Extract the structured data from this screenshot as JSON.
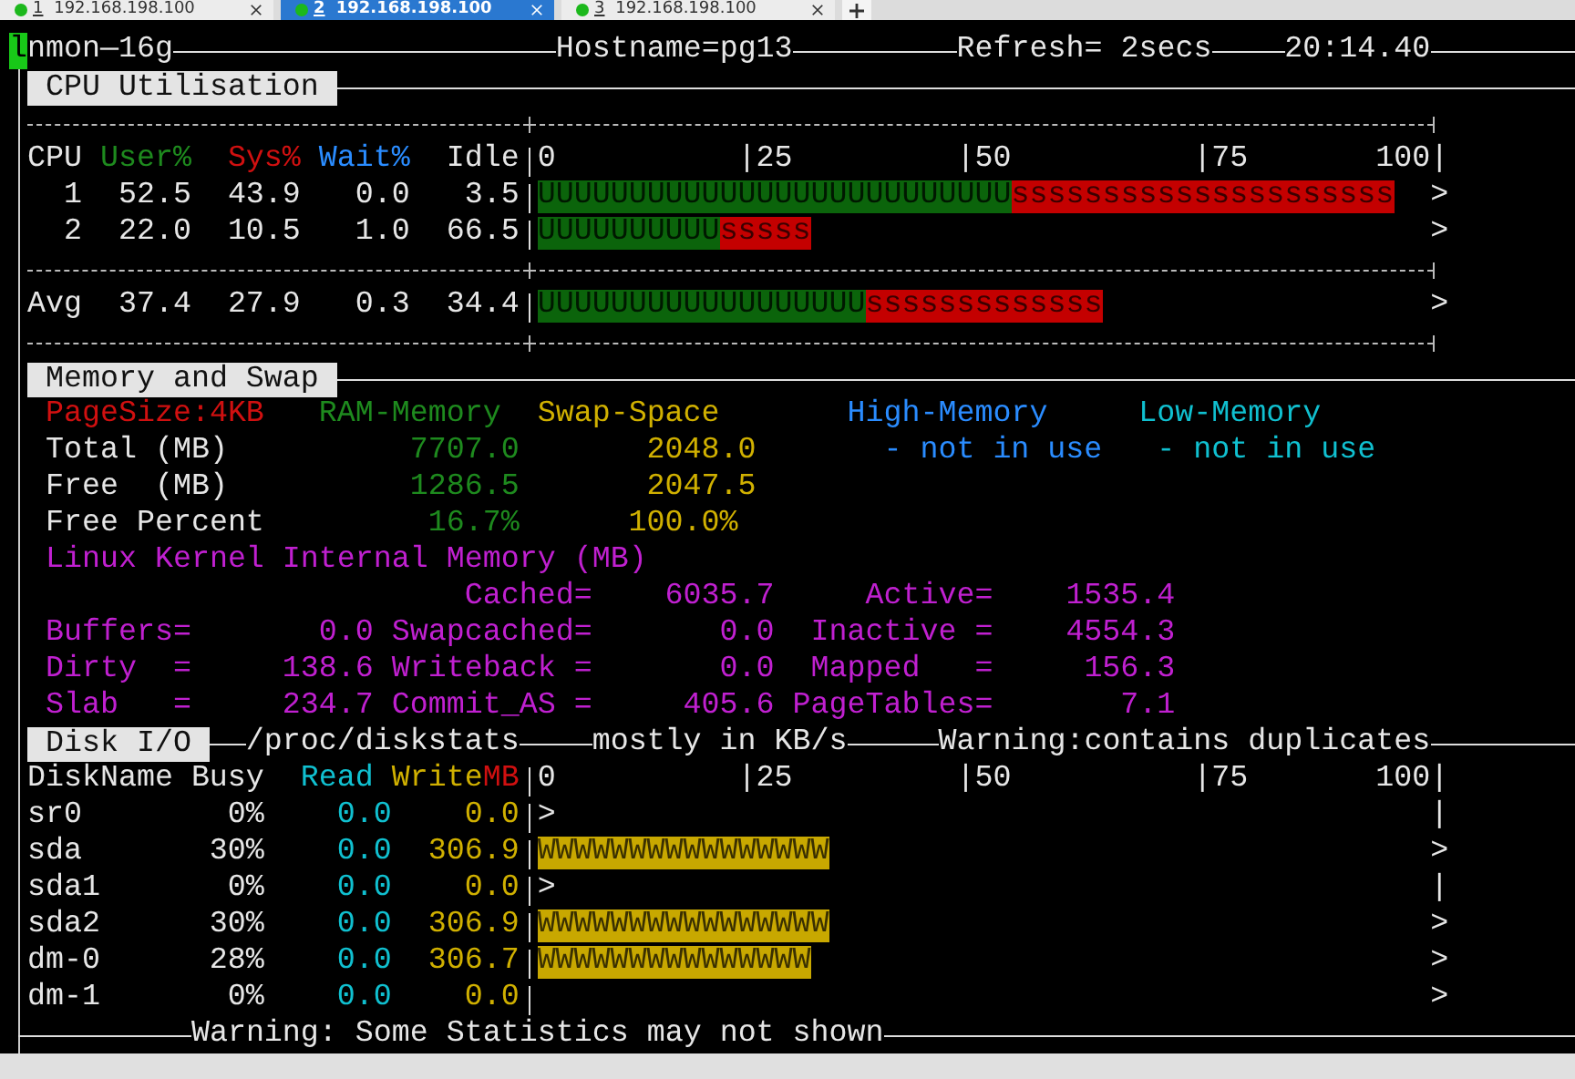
{
  "tabs": [
    {
      "number": "1",
      "address": "192.168.198.100",
      "selected": false
    },
    {
      "number": "2",
      "address": "192.168.198.100",
      "selected": true
    },
    {
      "number": "3",
      "address": "192.168.198.100",
      "selected": false
    }
  ],
  "header": {
    "cursor": "l",
    "program": "nmon—16g",
    "hostname": "Hostname=pg13",
    "refresh": "Refresh= 2secs",
    "time": "20:14.40"
  },
  "cpu": {
    "title": "CPU Utilisation",
    "columns": {
      "cpu": "CPU",
      "user": "User%",
      "sys": "Sys%",
      "wait": "Wait%",
      "idle": "Idle"
    },
    "scale": [
      "0",
      "|25",
      "|50",
      "|75",
      "100|"
    ],
    "rows": [
      {
        "cpu": "1",
        "user": "52.5",
        "sys": "43.9",
        "wait": "0.0",
        "idle": "3.5",
        "user_bar": "UUUUUUUUUUUUUUUUUUUUUUUUUU",
        "sys_bar": "sssssssssssssssssssss",
        "end_mark": ">"
      },
      {
        "cpu": "2",
        "user": "22.0",
        "sys": "10.5",
        "wait": "1.0",
        "idle": "66.5",
        "user_bar": "UUUUUUUUUU",
        "sys_bar": "sssss",
        "end_mark": ">"
      }
    ],
    "average": {
      "cpu": "Avg",
      "user": "37.4",
      "sys": "27.9",
      "wait": "0.3",
      "idle": "34.4",
      "user_bar": "UUUUUUUUUUUUUUUUUU",
      "sys_bar": "sssssssssssss",
      "end_mark": ">"
    }
  },
  "memory": {
    "title": "Memory and Swap",
    "page_size": "PageSize:4KB",
    "ram_heading": "RAM-Memory",
    "swap_heading": "Swap-Space",
    "high_heading": "High-Memory",
    "low_heading": "Low-Memory",
    "rows": [
      {
        "kind": "mb",
        "label": "Total (MB)",
        "ram": "7707.0",
        "swap": "2048.0",
        "high": "- not in use",
        "low": "- not in use"
      },
      {
        "kind": "mb",
        "label": "Free  (MB)",
        "ram": "1286.5",
        "swap": "2047.5"
      },
      {
        "kind": "percent",
        "label": "Free Percent",
        "ram": "16.7%",
        "swap": "100.0%"
      }
    ],
    "kernel_title": "Linux Kernel Internal Memory (MB)",
    "kernel_rows": [
      {
        "entries": [
          {
            "label": "Cached=",
            "value": "6035.7"
          },
          {
            "label": "Active=",
            "value": "1535.4"
          }
        ]
      },
      {
        "entries": [
          {
            "label": "Buffers=",
            "value": "0.0"
          },
          {
            "label": "Swapcached=",
            "value": "0.0"
          },
          {
            "label": "Inactive =",
            "value": "4554.3"
          }
        ]
      },
      {
        "entries": [
          {
            "label": "Dirty  =",
            "value": "138.6"
          },
          {
            "label": "Writeback =",
            "value": "0.0"
          },
          {
            "label": "Mapped   =",
            "value": "156.3"
          }
        ]
      },
      {
        "entries": [
          {
            "label": "Slab   =",
            "value": "234.7"
          },
          {
            "label": "Commit_AS =",
            "value": "405.6"
          },
          {
            "label": "PageTables=",
            "value": "7.1"
          }
        ]
      }
    ]
  },
  "disk": {
    "title": "Disk I/O",
    "source": "/proc/diskstats",
    "units": "mostly in KB/s",
    "warning": "Warning:contains duplicates",
    "columns": {
      "name": "DiskName",
      "busy": "Busy",
      "read": "Read",
      "write": "Write",
      "unit": "MB"
    },
    "scale": [
      "0",
      "|25",
      "|50",
      "|75",
      "100|"
    ],
    "rows": [
      {
        "kind": "idle",
        "name": "sr0",
        "busy": "0%",
        "read": "0.0",
        "write": "0.0",
        "bar": ">",
        "end_mark": "|"
      },
      {
        "kind": "bar",
        "name": "sda",
        "busy": "30%",
        "read": "0.0",
        "write": "306.9",
        "bar": "WWWWWWWWWWWWWWWW",
        "end_mark": ">"
      },
      {
        "kind": "idle",
        "name": "sda1",
        "busy": "0%",
        "read": "0.0",
        "write": "0.0",
        "bar": ">",
        "end_mark": "|"
      },
      {
        "kind": "bar",
        "name": "sda2",
        "busy": "30%",
        "read": "0.0",
        "write": "306.9",
        "bar": "WWWWWWWWWWWWWWWW",
        "end_mark": ">"
      },
      {
        "kind": "bar",
        "name": "dm-0",
        "busy": "28%",
        "read": "0.0",
        "write": "306.7",
        "bar": "WWWWWWWWWWWWWWW",
        "end_mark": ">"
      },
      {
        "kind": "blank",
        "name": "dm-1",
        "busy": "0%",
        "read": "0.0",
        "write": "0.0",
        "end_mark": ">"
      }
    ]
  },
  "footer": "Warning: Some Statistics may not shown"
}
